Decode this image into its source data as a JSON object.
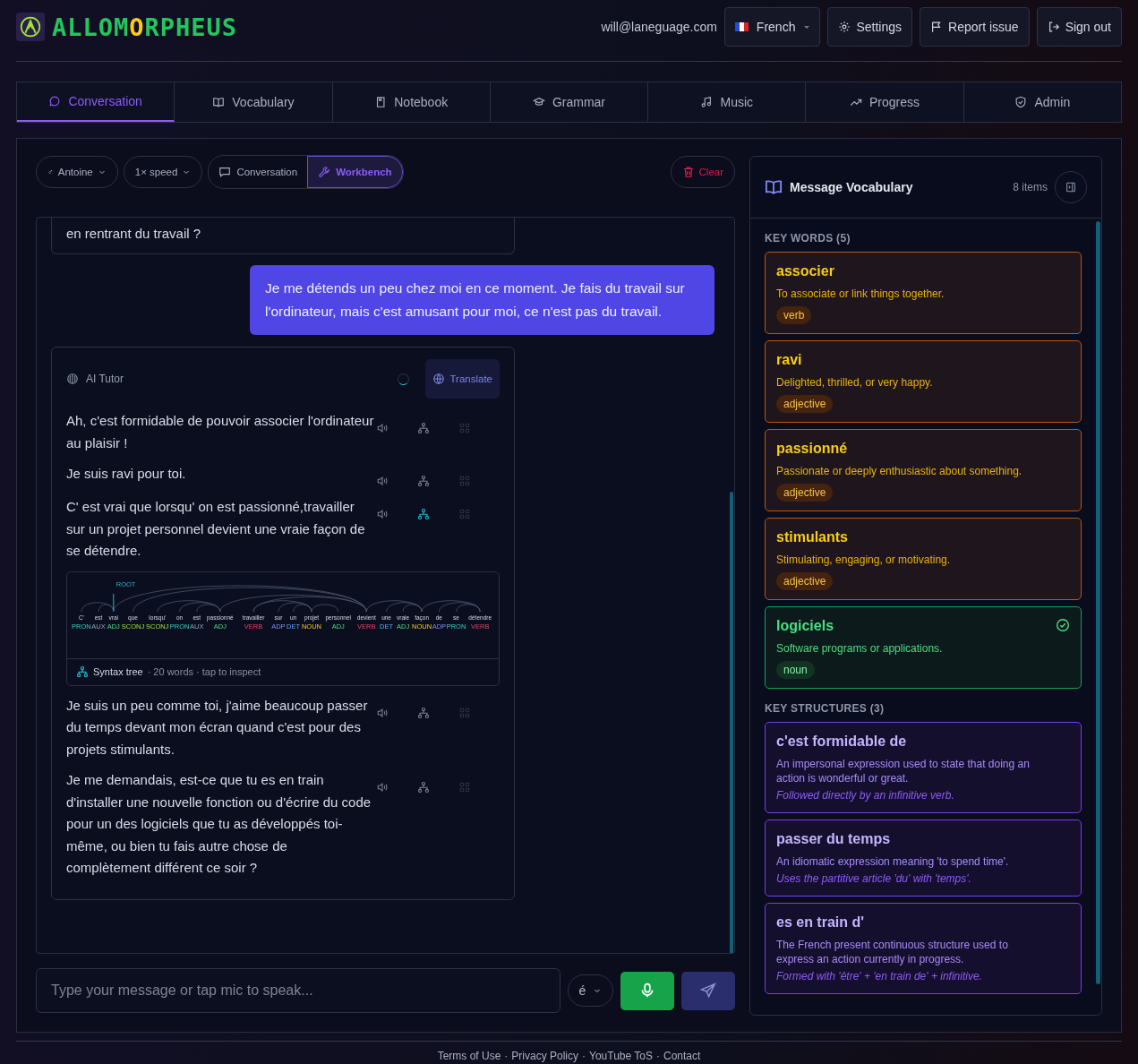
{
  "header": {
    "logo": [
      {
        "text": "ALLOM",
        "highlight": false
      },
      {
        "text": "O",
        "highlight": true
      },
      {
        "text": "RPHEUS",
        "highlight": false
      }
    ],
    "email": "will@laneguage.com",
    "language": "French",
    "buttons": [
      "Settings",
      "Report issue",
      "Sign out"
    ]
  },
  "tabs": [
    {
      "label": "Conversation",
      "selected": true
    },
    {
      "label": "Vocabulary",
      "selected": false
    },
    {
      "label": "Notebook",
      "selected": false
    },
    {
      "label": "Grammar",
      "selected": false
    },
    {
      "label": "Music",
      "selected": false
    },
    {
      "label": "Progress",
      "selected": false
    },
    {
      "label": "Admin",
      "selected": false
    }
  ],
  "toolbar": {
    "voice_symbol": "♂",
    "voice": "Antoine",
    "speed": "1× speed",
    "modes": [
      {
        "label": "Conversation",
        "selected": false
      },
      {
        "label": "Workbench",
        "selected": true
      }
    ],
    "clear": "Clear"
  },
  "chat": {
    "partial_message": "en rentrant du travail ?",
    "user_message": "Je me détends un peu chez moi en ce moment. Je fais du travail sur l'ordinateur, mais c'est amusant pour moi, ce n'est pas du travail.",
    "tutor": {
      "name": "AI Tutor",
      "translate": "Translate",
      "sentences": [
        {
          "text": "Ah, c'est formidable de pouvoir associer l'ordinateur au plaisir !",
          "tree_open": false
        },
        {
          "text": "Je suis ravi pour toi.",
          "tree_open": false
        },
        {
          "text": "C' est vrai que lorsqu' on est passionné,travailler sur un projet personnel devient une vraie façon de se détendre.",
          "tree_open": true
        },
        {
          "text": "Je suis un peu comme toi, j'aime beaucoup passer du temps devant mon écran quand c'est pour des projets stimulants.",
          "tree_open": false
        },
        {
          "text": "Je me demandais, est-ce que tu es en train d'installer une nouvelle fonction ou d'écrire du code pour un des logiciels que tu as développés toi-même, ou bien tu fais autre chose de complètement différent ce soir ?",
          "tree_open": false
        }
      ],
      "syntax": {
        "title": "Syntax tree",
        "meta": "· 20 words · tap to inspect",
        "root_label": "ROOT",
        "tokens": [
          {
            "word": "C'",
            "pos": "PRON",
            "kind": "pronoun"
          },
          {
            "word": "est",
            "pos": "AUX",
            "kind": "auxiliary"
          },
          {
            "word": "vrai",
            "pos": "ADJ",
            "kind": "adjective"
          },
          {
            "word": "que",
            "pos": "SCONJ",
            "kind": "conjunction"
          },
          {
            "word": "lorsqu'",
            "pos": "SCONJ",
            "kind": "conjunction"
          },
          {
            "word": "on",
            "pos": "PRON",
            "kind": "pronoun"
          },
          {
            "word": "est",
            "pos": "AUX",
            "kind": "auxiliary"
          },
          {
            "word": "passionné",
            "pos": "ADJ",
            "kind": "adjective"
          },
          {
            "word": "travailler",
            "pos": "VERB",
            "kind": "verb"
          },
          {
            "word": "sur",
            "pos": "ADP",
            "kind": "adposition"
          },
          {
            "word": "un",
            "pos": "DET",
            "kind": "determiner"
          },
          {
            "word": "projet",
            "pos": "NOUN",
            "kind": "noun"
          },
          {
            "word": "personnel",
            "pos": "ADJ",
            "kind": "adjective"
          },
          {
            "word": "devient",
            "pos": "VERB",
            "kind": "verb"
          },
          {
            "word": "une",
            "pos": "DET",
            "kind": "determiner"
          },
          {
            "word": "vraie",
            "pos": "ADJ",
            "kind": "adjective"
          },
          {
            "word": "façon",
            "pos": "NOUN",
            "kind": "noun"
          },
          {
            "word": "de",
            "pos": "ADP",
            "kind": "adposition"
          },
          {
            "word": "se",
            "pos": "PRON",
            "kind": "pronoun"
          },
          {
            "word": "détendre",
            "pos": "VERB",
            "kind": "verb"
          }
        ]
      }
    }
  },
  "composer": {
    "placeholder": "Type your message or tap mic to speak...",
    "accent": "é"
  },
  "vocab": {
    "title": "Message Vocabulary",
    "count": "8 items",
    "sections": [
      {
        "heading": "KEY WORDS (5)",
        "items": [
          {
            "kind": "word",
            "term": "associer",
            "definition": "To associate or link things together.",
            "tag": "verb",
            "known": false
          },
          {
            "kind": "word",
            "term": "ravi",
            "definition": "Delighted, thrilled, or very happy.",
            "tag": "adjective",
            "known": false
          },
          {
            "kind": "word",
            "term": "passionné",
            "definition": "Passionate or deeply enthusiastic about something.",
            "tag": "adjective",
            "known": false
          },
          {
            "kind": "word",
            "term": "stimulants",
            "definition": "Stimulating, engaging, or motivating.",
            "tag": "adjective",
            "known": false
          },
          {
            "kind": "word",
            "term": "logiciels",
            "definition": "Software programs or applications.",
            "tag": "noun",
            "known": true
          }
        ]
      },
      {
        "heading": "KEY STRUCTURES (3)",
        "items": [
          {
            "kind": "structure",
            "term": "c'est formidable de",
            "definition": "An impersonal expression used to state that doing an action is wonderful or great.",
            "note": "Followed directly by an infinitive verb."
          },
          {
            "kind": "structure",
            "term": "passer du temps",
            "definition": "An idiomatic expression meaning 'to spend time'.",
            "note": "Uses the partitive article 'du' with 'temps'."
          },
          {
            "kind": "structure",
            "term": "es en train d'",
            "definition": "The French present continuous structure used to express an action currently in progress.",
            "note": "Formed with 'être' + 'en train de' + infinitive."
          }
        ]
      }
    ]
  },
  "footer": {
    "links": [
      "Terms of Use",
      "Privacy Policy",
      "YouTube ToS",
      "Contact"
    ],
    "separator": "·"
  }
}
